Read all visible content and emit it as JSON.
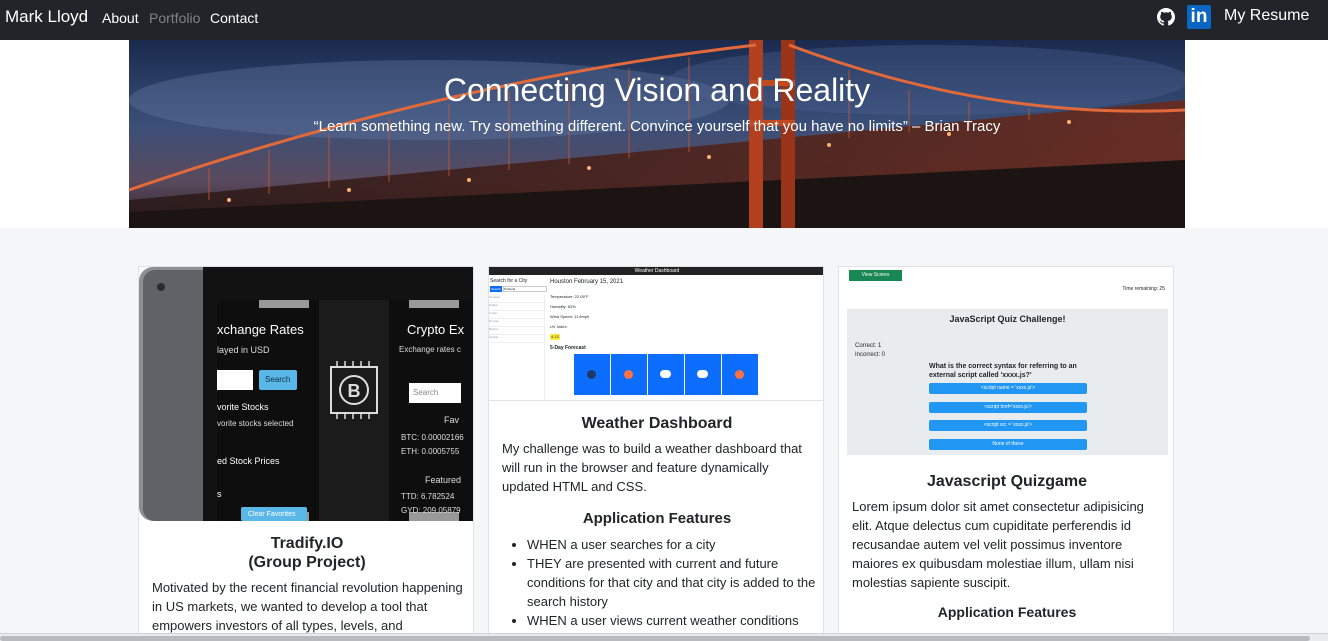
{
  "nav": {
    "brand": "Mark Lloyd",
    "links": [
      "About",
      "Portfolio",
      "Contact"
    ],
    "github_icon": "github-icon",
    "linkedin_icon": "linkedin-icon",
    "linkedin_glyph": "in",
    "resume": "My Resume"
  },
  "hero": {
    "title": "Connecting Vision and Reality",
    "quote": "“Learn something new. Try something different. Convince yourself that you have no limits” – Brian Tracy"
  },
  "cards": [
    {
      "title": "Tradify.IO",
      "subtitle": "(Group Project)",
      "text": "Motivated by the recent financial revolution happening in US markets, we wanted to develop a tool that empowers investors of all types, levels, and",
      "thumb": {
        "left_title": "xchange Rates",
        "left_sub": "layed in USD",
        "search_btn": "Search",
        "favorites": "vorite Stocks",
        "fav_none": "vorite stocks selected",
        "prices": "ed Stock Prices",
        "clear_btn": "Clear Favorites",
        "right_title": "Crypto Ex",
        "right_sub": "Exchange rates c",
        "search_placeholder": "Search",
        "fav_label": "Fav",
        "btc": "BTC: 0.00002166",
        "eth": "ETH: 0.0005755",
        "featured": "Featured",
        "ttd": "TTD: 6.782524",
        "gyd": "GYD: 209.05879",
        "s": "s"
      }
    },
    {
      "title": "Weather Dashboard",
      "text": "My challenge was to build a weather dashboard that will run in the browser and feature dynamically updated HTML and CSS.",
      "features_title": "Application Features",
      "features": [
        "WHEN a user searches for a city",
        "THEY are presented with current and future conditions for that city and that city is added to the search history",
        "WHEN a user views current weather conditions for"
      ],
      "thumb": {
        "header": "Weather Dashboard",
        "search_label": "Search for a City",
        "search_btn": "Search",
        "search_value": "Portland",
        "city": "Houston February 15, 2021",
        "temp": "Temperature: 22.05°F",
        "humidity": "Humidity: 63%",
        "wind": "Wind Speed: 11.5mph",
        "uv": "UV Index:",
        "uv_value": "4.13",
        "forecast": "5-Day Forecast",
        "history": [
          "Houston",
          "Dallas",
          "Austin",
          "Denver",
          "Boston",
          "Seattle"
        ]
      }
    },
    {
      "title": "Javascript Quizgame",
      "text": "Lorem ipsum dolor sit amet consectetur adipisicing elit. Atque delectus cum cupiditate perferendis id recusandae autem vel velit possimus inventore maiores ex quibusdam molestiae illum, ullam nisi molestias sapiente suscipit.",
      "features_title": "Application Features",
      "thumb": {
        "view_btn": "View Scores",
        "timer": "Time remaining: 25",
        "quiz_title": "JavaScript Quiz Challenge!",
        "correct": "Correct: 1",
        "incorrect": "Incorrect: 0",
        "question": "What is the correct syntax for referring to an external script called 'xxxx.js?'",
        "answers": [
          "<script name = 'xxxx.js'>",
          "<script href='xxxx.js'>",
          "<script src = 'xxxx.js'>",
          "None of these"
        ]
      }
    }
  ]
}
